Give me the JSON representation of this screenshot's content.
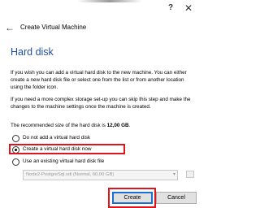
{
  "window": {
    "help_icon": "?",
    "close_icon": "✕"
  },
  "header": {
    "back_icon": "←",
    "title": "Create Virtual Machine"
  },
  "section": {
    "title": "Hard disk"
  },
  "paragraphs": {
    "p1": "If you wish you can add a virtual hard disk to the new machine. You can either create a new hard disk file or select one from the list or from another location using the folder icon.",
    "p2": "If you need a more complex storage set-up you can skip this step and make the changes to the machine settings once the machine is created.",
    "p3_prefix": "The recommended size of the hard disk is ",
    "p3_size": "12,00 GB",
    "p3_suffix": "."
  },
  "options": [
    {
      "label": "Do not add a virtual hard disk",
      "checked": false
    },
    {
      "label": "Create a virtual hard disk now",
      "checked": true
    },
    {
      "label": "Use an existing virtual hard disk file",
      "checked": false
    }
  ],
  "existing_file": {
    "value": "Node2-PostgreSql.vdi (Normal, 60,00 GB)"
  },
  "buttons": {
    "create": "Create",
    "cancel": "Cancel"
  },
  "colors": {
    "accent_title": "#1e4e9e",
    "highlight": "#e0141e",
    "default_button_border": "#1b6fd3"
  }
}
